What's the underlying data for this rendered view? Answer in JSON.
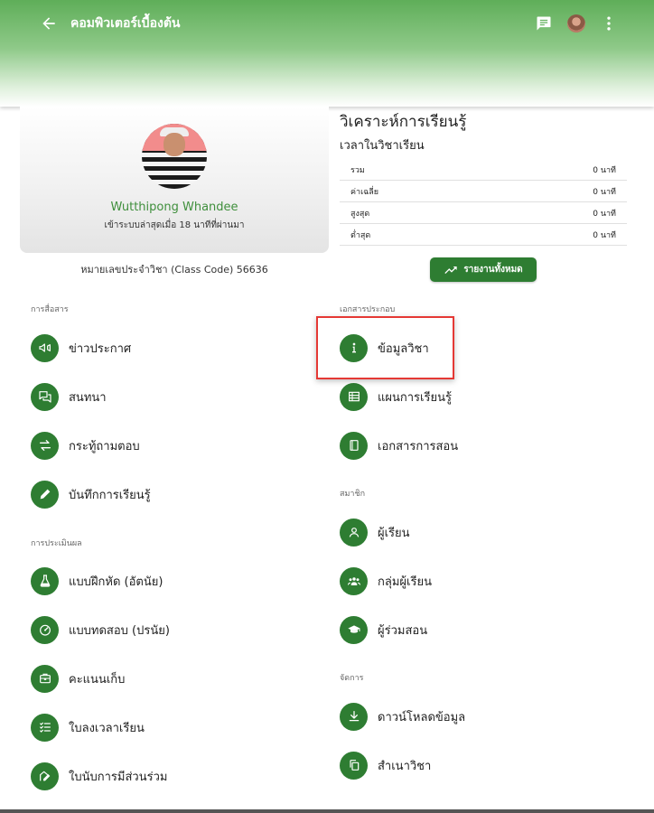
{
  "app": {
    "title": "คอมพิวเตอร์เบื้องต้น",
    "icons": {
      "back": "arrow-back-icon",
      "chat": "chat-icon",
      "more": "more-vert-icon"
    },
    "colors": {
      "primary": "#2e7d32",
      "header": "#5fae59",
      "highlight": "#e53935",
      "name": "#3f8f3c"
    }
  },
  "profile": {
    "name": "Wutthipong Whandee",
    "status": "เข้าระบบล่าสุดเมื่อ 18 นาทีที่ผ่านมา",
    "class_code": "หมายเลขประจำวิชา (Class Code) 56636"
  },
  "analytics": {
    "title": "วิเคราะห์การเรียนรู้",
    "subtitle": "เวลาในวิชาเรียน",
    "rows": [
      {
        "label": "รวม",
        "value": "0 นาที"
      },
      {
        "label": "ค่าเฉลี่ย",
        "value": "0 นาที"
      },
      {
        "label": "สูงสุด",
        "value": "0 นาที"
      },
      {
        "label": "ต่ำสุด",
        "value": "0 นาที"
      }
    ],
    "report_button": "รายงานทั้งหมด"
  },
  "sections": {
    "communication": {
      "label": "การสื่อสาร",
      "items": [
        {
          "label": "ข่าวประกาศ",
          "icon": "megaphone-icon"
        },
        {
          "label": "สนทนา",
          "icon": "forum-icon"
        },
        {
          "label": "กระทู้ถามตอบ",
          "icon": "swap-icon"
        },
        {
          "label": "บันทึกการเรียนรู้",
          "icon": "pencil-icon"
        }
      ]
    },
    "assessment": {
      "label": "การประเมินผล",
      "items": [
        {
          "label": "แบบฝึกหัด (อัตนัย)",
          "icon": "flask-icon"
        },
        {
          "label": "แบบทดสอบ (ปรนัย)",
          "icon": "speedometer-icon"
        },
        {
          "label": "คะแนนเก็บ",
          "icon": "briefcase-icon"
        },
        {
          "label": "ใบลงเวลาเรียน",
          "icon": "checklist-icon"
        },
        {
          "label": "ใบนับการมีส่วนร่วม",
          "icon": "edit-note-icon"
        }
      ]
    },
    "documents": {
      "label": "เอกสารประกอบ",
      "items": [
        {
          "label": "ข้อมูลวิชา",
          "icon": "info-icon"
        },
        {
          "label": "แผนการเรียนรู้",
          "icon": "table-icon"
        },
        {
          "label": "เอกสารการสอน",
          "icon": "book-icon"
        }
      ]
    },
    "members": {
      "label": "สมาชิก",
      "items": [
        {
          "label": "ผู้เรียน",
          "icon": "person-icon"
        },
        {
          "label": "กลุ่มผู้เรียน",
          "icon": "group-icon"
        },
        {
          "label": "ผู้ร่วมสอน",
          "icon": "graduation-cap-icon"
        }
      ]
    },
    "manage": {
      "label": "จัดการ",
      "items": [
        {
          "label": "ดาวน์โหลดข้อมูล",
          "icon": "download-icon"
        },
        {
          "label": "สำเนาวิชา",
          "icon": "copy-icon"
        }
      ]
    }
  }
}
